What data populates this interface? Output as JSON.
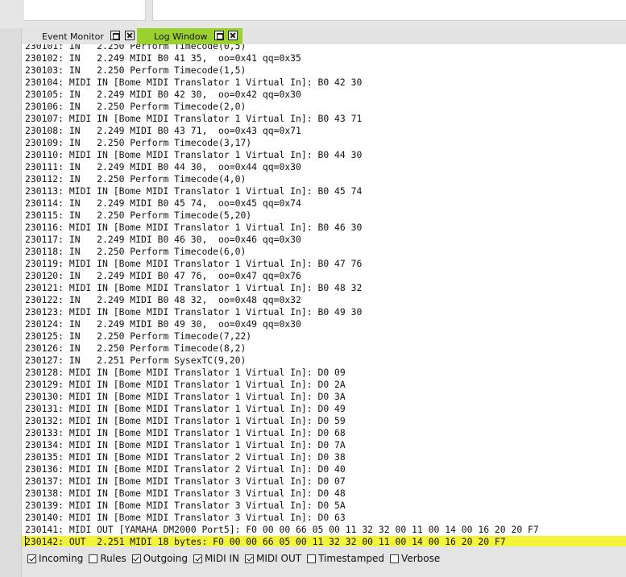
{
  "tabs": [
    {
      "label": "Event Monitor",
      "active": false
    },
    {
      "label": "Log Window",
      "active": true
    }
  ],
  "colors": {
    "active_tab": "#9bd12e",
    "highlight_row": "#f3f33a"
  },
  "log_lines": [
    "230101: IN   2.250 Perform Timecode(0,5)",
    "230102: IN   2.249 MIDI B0 41 35,  oo=0x41 qq=0x35",
    "230103: IN   2.250 Perform Timecode(1,5)",
    "230104: MIDI IN [Bome MIDI Translator 1 Virtual In]: B0 42 30",
    "230105: IN   2.249 MIDI B0 42 30,  oo=0x42 qq=0x30",
    "230106: IN   2.250 Perform Timecode(2,0)",
    "230107: MIDI IN [Bome MIDI Translator 1 Virtual In]: B0 43 71",
    "230108: IN   2.249 MIDI B0 43 71,  oo=0x43 qq=0x71",
    "230109: IN   2.250 Perform Timecode(3,17)",
    "230110: MIDI IN [Bome MIDI Translator 1 Virtual In]: B0 44 30",
    "230111: IN   2.249 MIDI B0 44 30,  oo=0x44 qq=0x30",
    "230112: IN   2.250 Perform Timecode(4,0)",
    "230113: MIDI IN [Bome MIDI Translator 1 Virtual In]: B0 45 74",
    "230114: IN   2.249 MIDI B0 45 74,  oo=0x45 qq=0x74",
    "230115: IN   2.250 Perform Timecode(5,20)",
    "230116: MIDI IN [Bome MIDI Translator 1 Virtual In]: B0 46 30",
    "230117: IN   2.249 MIDI B0 46 30,  oo=0x46 qq=0x30",
    "230118: IN   2.250 Perform Timecode(6,0)",
    "230119: MIDI IN [Bome MIDI Translator 1 Virtual In]: B0 47 76",
    "230120: IN   2.249 MIDI B0 47 76,  oo=0x47 qq=0x76",
    "230121: MIDI IN [Bome MIDI Translator 1 Virtual In]: B0 48 32",
    "230122: IN   2.249 MIDI B0 48 32,  oo=0x48 qq=0x32",
    "230123: MIDI IN [Bome MIDI Translator 1 Virtual In]: B0 49 30",
    "230124: IN   2.249 MIDI B0 49 30,  oo=0x49 qq=0x30",
    "230125: IN   2.250 Perform Timecode(7,22)",
    "230126: IN   2.250 Perform Timecode(8,2)",
    "230127: IN   2.251 Perform SysexTC(9,20)",
    "230128: MIDI IN [Bome MIDI Translator 1 Virtual In]: D0 09",
    "230129: MIDI IN [Bome MIDI Translator 1 Virtual In]: D0 2A",
    "230130: MIDI IN [Bome MIDI Translator 1 Virtual In]: D0 3A",
    "230131: MIDI IN [Bome MIDI Translator 1 Virtual In]: D0 49",
    "230132: MIDI IN [Bome MIDI Translator 1 Virtual In]: D0 59",
    "230133: MIDI IN [Bome MIDI Translator 1 Virtual In]: D0 68",
    "230134: MIDI IN [Bome MIDI Translator 1 Virtual In]: D0 7A",
    "230135: MIDI IN [Bome MIDI Translator 2 Virtual In]: D0 38",
    "230136: MIDI IN [Bome MIDI Translator 2 Virtual In]: D0 40",
    "230137: MIDI IN [Bome MIDI Translator 3 Virtual In]: D0 07",
    "230138: MIDI IN [Bome MIDI Translator 3 Virtual In]: D0 48",
    "230139: MIDI IN [Bome MIDI Translator 3 Virtual In]: D0 5A",
    "230140: MIDI IN [Bome MIDI Translator 3 Virtual In]: D0 63",
    "230141: MIDI OUT [YAMAHA DM2000 Port5]: F0 00 00 66 05 00 11 32 32 00 11 00 14 00 16 20 20 F7",
    "230142: OUT  2.251 MIDI 18 bytes: F0 00 00 66 05 00 11 32 32 00 11 00 14 00 16 20 20 F7"
  ],
  "highlighted_line": "230142: OUT  2.251 MIDI 18 bytes: F0 00 00 66 05 00 11 32 32 00 11 00 14 00 16 20 20 F7",
  "filters": [
    {
      "label": "Incoming",
      "checked": true
    },
    {
      "label": "Rules",
      "checked": false
    },
    {
      "label": "Outgoing",
      "checked": true
    },
    {
      "label": "MIDI IN",
      "checked": true
    },
    {
      "label": "MIDI OUT",
      "checked": true
    },
    {
      "label": "Timestamped",
      "checked": false
    },
    {
      "label": "Verbose",
      "checked": false
    }
  ]
}
